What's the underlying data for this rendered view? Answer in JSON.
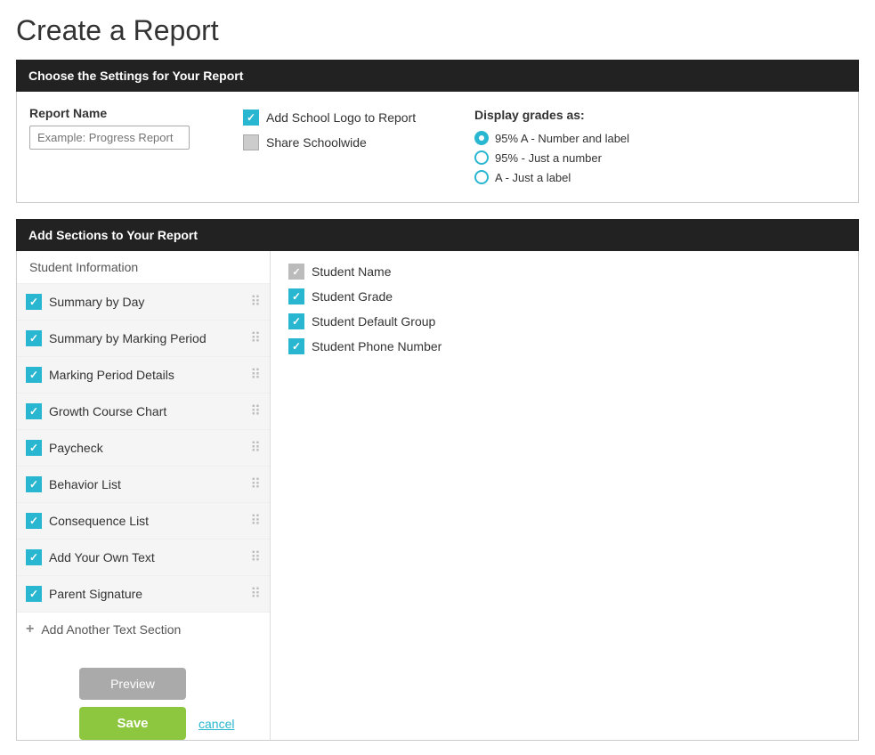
{
  "page": {
    "title": "Create a Report"
  },
  "settings_header": "Choose the Settings for Your Report",
  "sections_header": "Add Sections to Your Report",
  "report_name": {
    "label": "Report Name",
    "placeholder": "Example: Progress Report"
  },
  "logo_options": {
    "add_logo": {
      "checked": true,
      "label": "Add School Logo to Report"
    },
    "share_schoolwide": {
      "checked": false,
      "label": "Share Schoolwide"
    }
  },
  "display_grades": {
    "title": "Display grades as:",
    "options": [
      {
        "id": "opt1",
        "label": "95% A - Number and label",
        "selected": true
      },
      {
        "id": "opt2",
        "label": "95% - Just a number",
        "selected": false
      },
      {
        "id": "opt3",
        "label": "A - Just a label",
        "selected": false
      }
    ]
  },
  "sections": {
    "static_item": "Student Information",
    "list_items": [
      {
        "label": "Summary by Day",
        "checked": true
      },
      {
        "label": "Summary by Marking Period",
        "checked": true
      },
      {
        "label": "Marking Period Details",
        "checked": true
      },
      {
        "label": "Growth Course Chart",
        "checked": true
      },
      {
        "label": "Paycheck",
        "checked": true
      },
      {
        "label": "Behavior List",
        "checked": true
      },
      {
        "label": "Consequence List",
        "checked": true
      },
      {
        "label": "Add Your Own Text",
        "checked": true
      },
      {
        "label": "Parent Signature",
        "checked": true
      }
    ],
    "add_another": "Add Another Text Section"
  },
  "student_info_checks": [
    {
      "label": "Student Name",
      "checked": false
    },
    {
      "label": "Student Grade",
      "checked": true
    },
    {
      "label": "Student Default Group",
      "checked": true
    },
    {
      "label": "Student Phone Number",
      "checked": true
    }
  ],
  "buttons": {
    "preview": "Preview",
    "save": "Save",
    "cancel": "cancel"
  }
}
